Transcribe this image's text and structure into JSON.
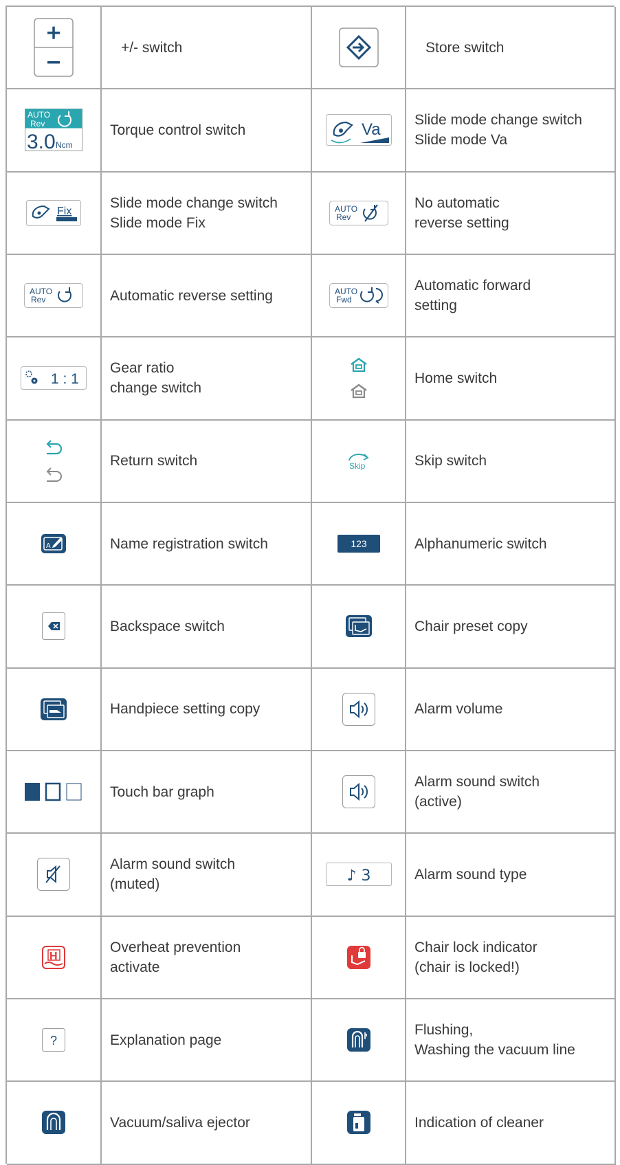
{
  "rows": [
    {
      "left_icon": "plus-minus-switch-icon",
      "left_label": "+/- switch",
      "right_icon": "store-switch-icon",
      "right_label": "Store switch"
    },
    {
      "left_icon": "torque-control-switch-icon",
      "left_label": "Torque control switch",
      "right_icon": "slide-mode-va-icon",
      "right_label": "Slide mode change switch\nSlide mode Va"
    },
    {
      "left_icon": "slide-mode-fix-icon",
      "left_label": "Slide mode change switch\nSlide mode Fix",
      "right_icon": "no-auto-reverse-icon",
      "right_label": "No automatic\nreverse setting"
    },
    {
      "left_icon": "auto-reverse-icon",
      "left_label": "Automatic reverse setting",
      "right_icon": "auto-forward-icon",
      "right_label": "Automatic forward\nsetting"
    },
    {
      "left_icon": "gear-ratio-icon",
      "left_label": "Gear ratio\nchange switch",
      "right_icon": "home-icon",
      "right_label": "Home switch"
    },
    {
      "left_icon": "return-icon",
      "left_label": "Return switch",
      "right_icon": "skip-icon",
      "right_label": "Skip switch"
    },
    {
      "left_icon": "name-registration-icon",
      "left_label": "Name registration switch",
      "right_icon": "alphanumeric-icon",
      "right_label": "Alphanumeric switch"
    },
    {
      "left_icon": "backspace-icon",
      "left_label": "Backspace switch",
      "right_icon": "chair-preset-copy-icon",
      "right_label": "Chair preset copy"
    },
    {
      "left_icon": "handpiece-setting-copy-icon",
      "left_label": "Handpiece setting copy",
      "right_icon": "alarm-volume-icon",
      "right_label": "Alarm volume"
    },
    {
      "left_icon": "touch-bar-graph-icon",
      "left_label": "Touch bar graph",
      "right_icon": "alarm-sound-active-icon",
      "right_label": "Alarm sound switch\n(active)"
    },
    {
      "left_icon": "alarm-sound-muted-icon",
      "left_label": "Alarm sound switch\n(muted)",
      "right_icon": "alarm-sound-type-icon",
      "right_label": "Alarm sound type"
    },
    {
      "left_icon": "overheat-prevention-icon",
      "left_label": "Overheat prevention\nactivate",
      "right_icon": "chair-lock-icon",
      "right_label": "Chair lock indicator\n(chair is locked!)"
    },
    {
      "left_icon": "explanation-page-icon",
      "left_label": "Explanation page",
      "right_icon": "flushing-icon",
      "right_label": "Flushing,\nWashing the vacuum line"
    },
    {
      "left_icon": "vacuum-saliva-ejector-icon",
      "left_label": "Vacuum/saliva ejector",
      "right_icon": "cleaner-indication-icon",
      "right_label": "Indication of cleaner"
    }
  ],
  "icon_text": {
    "auto": "AUTO",
    "rev": "Rev",
    "fwd": "Fwd",
    "torque_value": "3.0",
    "torque_unit": "Ncm",
    "va": "Va",
    "fix": "Fix",
    "gear_ratio": "1 : 1",
    "skip": "Skip",
    "alnum": "123",
    "sound_type": "♪ 3",
    "question": "?"
  },
  "colors": {
    "teal": "#2aa6b0",
    "navy": "#1f4e79",
    "red": "#e03a3a",
    "gray": "#8a8a8a",
    "grid": "#a9a9a9",
    "text": "#3a3a3a"
  }
}
